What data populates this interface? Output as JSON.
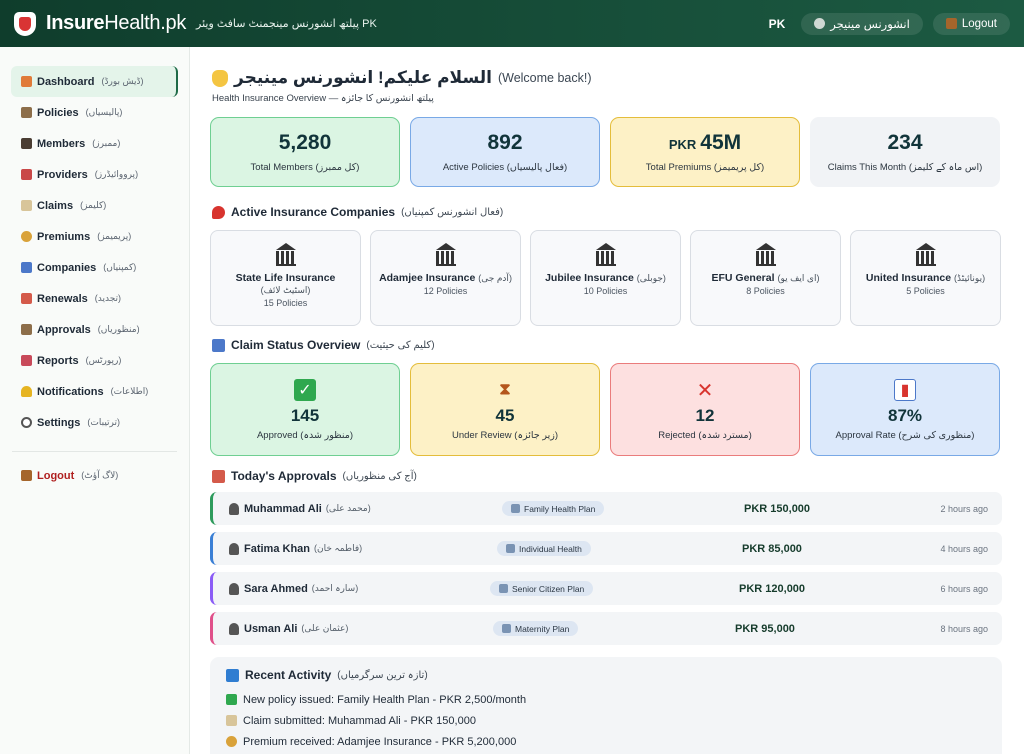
{
  "header": {
    "brand_main": "Insure",
    "brand_health": "Health.pk",
    "tagline": "پیلتھ انشورنس مینجمنٹ سافٹ ویئر PK",
    "country": "PK",
    "manager_label": "انشورنس مینیجر",
    "logout_label": "Logout",
    "colors": {
      "bar": "#0f3d2c",
      "accent": "#1e6a47"
    }
  },
  "sidebar": {
    "items": [
      {
        "label": "Dashboard",
        "urdu": "(ڈیش بورڈ)",
        "icon": "home-icon"
      },
      {
        "label": "Policies",
        "urdu": "(پالیسیاں)",
        "icon": "clipboard-icon"
      },
      {
        "label": "Members",
        "urdu": "(ممبرز)",
        "icon": "members-icon"
      },
      {
        "label": "Providers",
        "urdu": "(پرووائیڈرز)",
        "icon": "hospital-icon"
      },
      {
        "label": "Claims",
        "urdu": "(کلیمز)",
        "icon": "memo-icon"
      },
      {
        "label": "Premiums",
        "urdu": "(پریمیمز)",
        "icon": "moneybag-icon"
      },
      {
        "label": "Companies",
        "urdu": "(کمپنیاں)",
        "icon": "bar-chart-icon"
      },
      {
        "label": "Renewals",
        "urdu": "(تجدید)",
        "icon": "calendar-icon"
      },
      {
        "label": "Approvals",
        "urdu": "(منظوریاں)",
        "icon": "clipboard-icon"
      },
      {
        "label": "Reports",
        "urdu": "(رپورٹس)",
        "icon": "line-chart-icon"
      },
      {
        "label": "Notifications",
        "urdu": "(اطلاعات)",
        "icon": "bell-icon"
      },
      {
        "label": "Settings",
        "urdu": "(ترتیبات)",
        "icon": "gear-icon"
      }
    ],
    "logout": {
      "label": "Logout",
      "urdu": "(لاگ آؤٹ)"
    }
  },
  "welcome": {
    "title": "السلام علیکم! انشورنس مینیجر",
    "sub": "(Welcome back!)",
    "overview": "Health Insurance Overview — پیلتھ انشورنس کا جائزہ"
  },
  "stats": [
    {
      "prefix": "",
      "value": "5,280",
      "caption": "Total Members (کل ممبرز)"
    },
    {
      "prefix": "",
      "value": "892",
      "caption": "Active Policies (فعال پالیسیاں)"
    },
    {
      "prefix": "PKR",
      "value": "45M",
      "caption": "Total Premiums (کل پریمیمز)"
    },
    {
      "prefix": "",
      "value": "234",
      "caption": "Claims This Month (اس ماہ کے کلیمز)"
    }
  ],
  "companies_section": {
    "title": "Active Insurance Companies",
    "urdu": "(فعال انشورنس کمپنیاں)"
  },
  "companies": [
    {
      "name": "State Life Insurance",
      "urdu": "(اسٹیٹ لائف)",
      "policies": "15 Policies"
    },
    {
      "name": "Adamjee Insurance",
      "urdu": "(آدم جی)",
      "policies": "12 Policies"
    },
    {
      "name": "Jubilee Insurance",
      "urdu": "(جوبلی)",
      "policies": "10 Policies"
    },
    {
      "name": "EFU General",
      "urdu": "(ای ایف یو)",
      "policies": "8 Policies"
    },
    {
      "name": "United Insurance",
      "urdu": "(یونائیٹڈ)",
      "policies": "5 Policies"
    }
  ],
  "claims_section": {
    "title": "Claim Status Overview",
    "urdu": "(کلیم کی حیثیت)"
  },
  "claims": [
    {
      "value": "145",
      "caption": "Approved (منظور شدہ)",
      "icon": "check-icon",
      "glyph": "✓"
    },
    {
      "value": "45",
      "caption": "Under Review (زیر جائزہ)",
      "icon": "hourglass-icon",
      "glyph": "⧗"
    },
    {
      "value": "12",
      "caption": "Rejected (مسترد شدہ)",
      "icon": "cross-icon",
      "glyph": "✕"
    },
    {
      "value": "87%",
      "caption": "Approval Rate (منظوری کی شرح)",
      "icon": "bar-chart-icon",
      "glyph": "▮"
    }
  ],
  "approvals_section": {
    "title": "Today's Approvals",
    "urdu": "(آج کی منظوریاں)"
  },
  "approvals": [
    {
      "name": "Muhammad Ali",
      "urdu": "(محمد علی)",
      "plan": "Family Health Plan",
      "amount": "PKR 150,000",
      "time": "2 hours ago",
      "color": "#2e9b5c"
    },
    {
      "name": "Fatima Khan",
      "urdu": "(فاطمہ خان)",
      "plan": "Individual Health",
      "amount": "PKR 85,000",
      "time": "4 hours ago",
      "color": "#3a7fd5"
    },
    {
      "name": "Sara Ahmed",
      "urdu": "(سارہ احمد)",
      "plan": "Senior Citizen Plan",
      "amount": "PKR 120,000",
      "time": "6 hours ago",
      "color": "#8b5cf6"
    },
    {
      "name": "Usman Ali",
      "urdu": "(عثمان علی)",
      "plan": "Maternity Plan",
      "amount": "PKR 95,000",
      "time": "8 hours ago",
      "color": "#e0508a"
    }
  ],
  "recent": {
    "title": "Recent Activity",
    "urdu": "(تازہ ترین سرگرمیاں)",
    "items": [
      {
        "text": "New policy issued: Family Health Plan - PKR 2,500/month",
        "icon": "check-icon"
      },
      {
        "text": "Claim submitted: Muhammad Ali - PKR 150,000",
        "icon": "memo-icon"
      },
      {
        "text": "Premium received: Adamjee Insurance - PKR 5,200,000",
        "icon": "moneybag-icon"
      }
    ]
  }
}
